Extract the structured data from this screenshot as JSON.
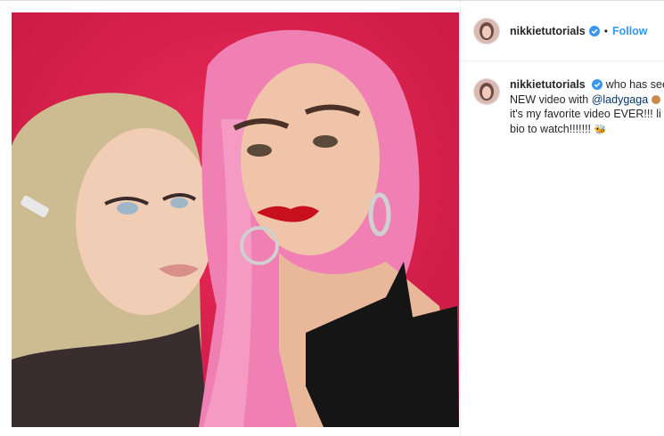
{
  "post": {
    "username": "nikkietutorials",
    "header_separator": "•",
    "follow_label": "Follow"
  },
  "caption": {
    "username": "nikkietutorials",
    "line1": "who has see",
    "line2_prefix": "NEW video with",
    "mention": "@ladygaga",
    "line3": "it's my favorite video EVER!!! li",
    "line4": "bio to watch!!!!!!!",
    "emoji_icon": "bee-icon"
  },
  "colors": {
    "accent": "#3897f0",
    "photo_background": "#e0224f"
  },
  "icons": {
    "verified": "verified-badge-icon"
  }
}
